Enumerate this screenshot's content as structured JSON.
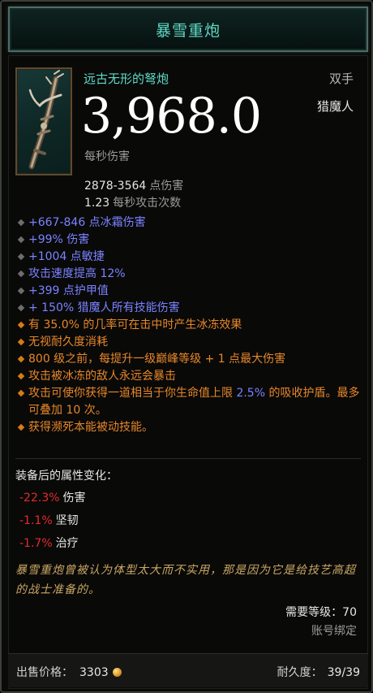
{
  "item": {
    "name": "暴雪重炮",
    "type": "远古无形的弩炮",
    "slot": "双手",
    "class": "猎魔人",
    "dps": "3,968.0",
    "dps_label": "每秒伤害",
    "damage_range": "2878-3564",
    "damage_range_label": "点伤害",
    "attack_speed": "1.23",
    "attack_speed_label": "每秒攻击次数",
    "icon": "crossbow-icon"
  },
  "affixes": [
    {
      "type": "grey",
      "text": "+667-846 点冰霜伤害"
    },
    {
      "type": "grey",
      "text": "+99% 伤害"
    },
    {
      "type": "grey",
      "text": "+1004 点敏捷"
    },
    {
      "type": "grey",
      "text": "攻击速度提高 12%"
    },
    {
      "type": "grey",
      "text": "+399 点护甲值"
    },
    {
      "type": "grey",
      "text": "+ 150% 猎魔人所有技能伤害"
    },
    {
      "type": "orange",
      "text": "有 35.0% 的几率可在击中时产生冰冻效果"
    },
    {
      "type": "orange",
      "text": "无视耐久度消耗"
    },
    {
      "type": "orange",
      "text": "800 级之前，每提升一级巅峰等级 + 1 点最大伤害"
    },
    {
      "type": "orange",
      "text": "攻击被冰冻的敌人永远会暴击"
    },
    {
      "type": "orange-legendary",
      "text_before": "攻击可使你获得一道相当于你生命值上限 ",
      "highlight": "2.5%",
      "text_after": " 的吸收护盾。最多可叠加 10 次。"
    },
    {
      "type": "orange",
      "text": "获得濒死本能被动技能。"
    }
  ],
  "stat_changes": {
    "title": "装备后的属性变化：",
    "items": [
      {
        "value": "-22.3%",
        "label": "伤害"
      },
      {
        "value": "-1.1%",
        "label": "坚韧"
      },
      {
        "value": "-1.7%",
        "label": "治疗"
      }
    ]
  },
  "flavor_text": "暴雪重炮曾被认为体型太大而不实用，那是因为它是给技艺高超的战士准备的。",
  "requirement": "需要等级：70",
  "binding": "账号绑定",
  "footer": {
    "price_label": "出售价格：",
    "price_value": "3303",
    "durability_label": "耐久度：",
    "durability_value": "39/39"
  },
  "colors": {
    "title": "#60d9c5",
    "magic": "#7a83ff",
    "legendary": "#e7872a",
    "negative": "#e22d2d",
    "flavor": "#c9a763"
  }
}
